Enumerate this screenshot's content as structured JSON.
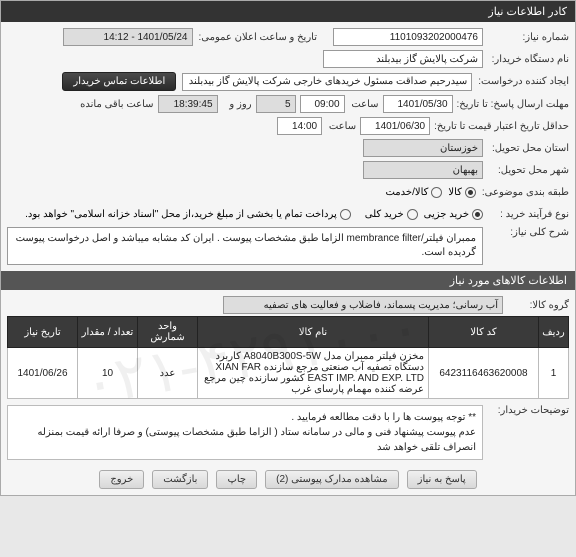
{
  "titlebar": "کادر اطلاعات نیاز",
  "fields": {
    "req_no_label": "شماره نیاز:",
    "req_no": "1101093202000476",
    "announce_label": "تاریخ و ساعت اعلان عمومی:",
    "announce": "1401/05/24 - 14:12",
    "buyer_label": "نام دستگاه خریدار:",
    "buyer": "شرکت پالایش گاز بیدبلند",
    "creator_label": "ایجاد کننده درخواست:",
    "creator": "سیدرحیم صداقت مسئول خریدهای خارجی شرکت پالایش گاز بیدبلند",
    "contact_btn": "اطلاعات تماس خریدار",
    "deadline_label": "حداقل تاریخ اعتبار قیمت تا تاریخ:",
    "deadline_date": "1401/05/30",
    "deadline_time_lbl": "ساعت",
    "deadline_time": "09:00",
    "days_lbl": "روز و",
    "days": "5",
    "remain_lbl": "ساعت باقی مانده",
    "remain": "18:39:45",
    "send_date_lbl": "مهلت ارسال پاسخ: تا تاریخ:",
    "send_date": "1401/06/30",
    "send_time_lbl": "ساعت",
    "send_time": "14:00",
    "province_label": "استان محل تحویل:",
    "province": "خوزستان",
    "city_label": "شهر محل تحویل:",
    "city": "بهبهان",
    "cat_label": "طبقه بندی موضوعی:",
    "cat_opt1": "کالا",
    "cat_opt2": "کالا/خدمت",
    "process_label": "نوع فرآیند خرید :",
    "process_opt1": "خرید جزیی",
    "process_opt2": "خرید کلی",
    "pay_note": "پرداخت تمام یا بخشی از مبلغ خرید،از محل \"اسناد خزانه اسلامی\" خواهد بود.",
    "desc_label": "شرح کلی نیاز:",
    "desc": "ممبران فیلتر/membrance filter الزاما طبق مشخصات پیوست . ایران کد مشابه میباشد و اصل درخواست پیوست گردیده است.",
    "items_header": "اطلاعات کالاهای مورد نیاز",
    "group_label": "گروه کالا:",
    "group": "آب رسانی؛ مدیریت پسماند، فاضلاب و فعالیت های تصفیه",
    "note": "** توجه پیوست ها  را با دقت مطالعه فرمایید .\nعدم پیوست پیشنهاد فنی و مالی در سامانه ستاد ( الزاما طبق مشخصات پیوستی)  و صرفا ارائه قیمت بمنزله انصراف تلقی خواهد شد",
    "note_label": "توضیحات خریدار:"
  },
  "table": {
    "headers": [
      "ردیف",
      "کد کالا",
      "نام کالا",
      "واحد شمارش",
      "تعداد / مقدار",
      "تاریخ نیاز"
    ],
    "row": {
      "idx": "1",
      "code": "6423116463620008",
      "name": "مخزن فیلتر ممبران مدل A8040B300S-5W کاربرد دستگاه تصفیه آب صنعتی مرجع سازنده XIAN FAR EAST IMP. AND EXP. LTD کشور سازنده چین مرجع عرضه کننده مهمام پارسای غرب",
      "unit": "عدد",
      "qty": "10",
      "date": "1401/06/26"
    }
  },
  "buttons": {
    "respond": "پاسخ به نیاز",
    "attachments": "مشاهده مدارک پیوستی (2)",
    "print": "چاپ",
    "back": "بازگشت",
    "exit": "خروج"
  }
}
